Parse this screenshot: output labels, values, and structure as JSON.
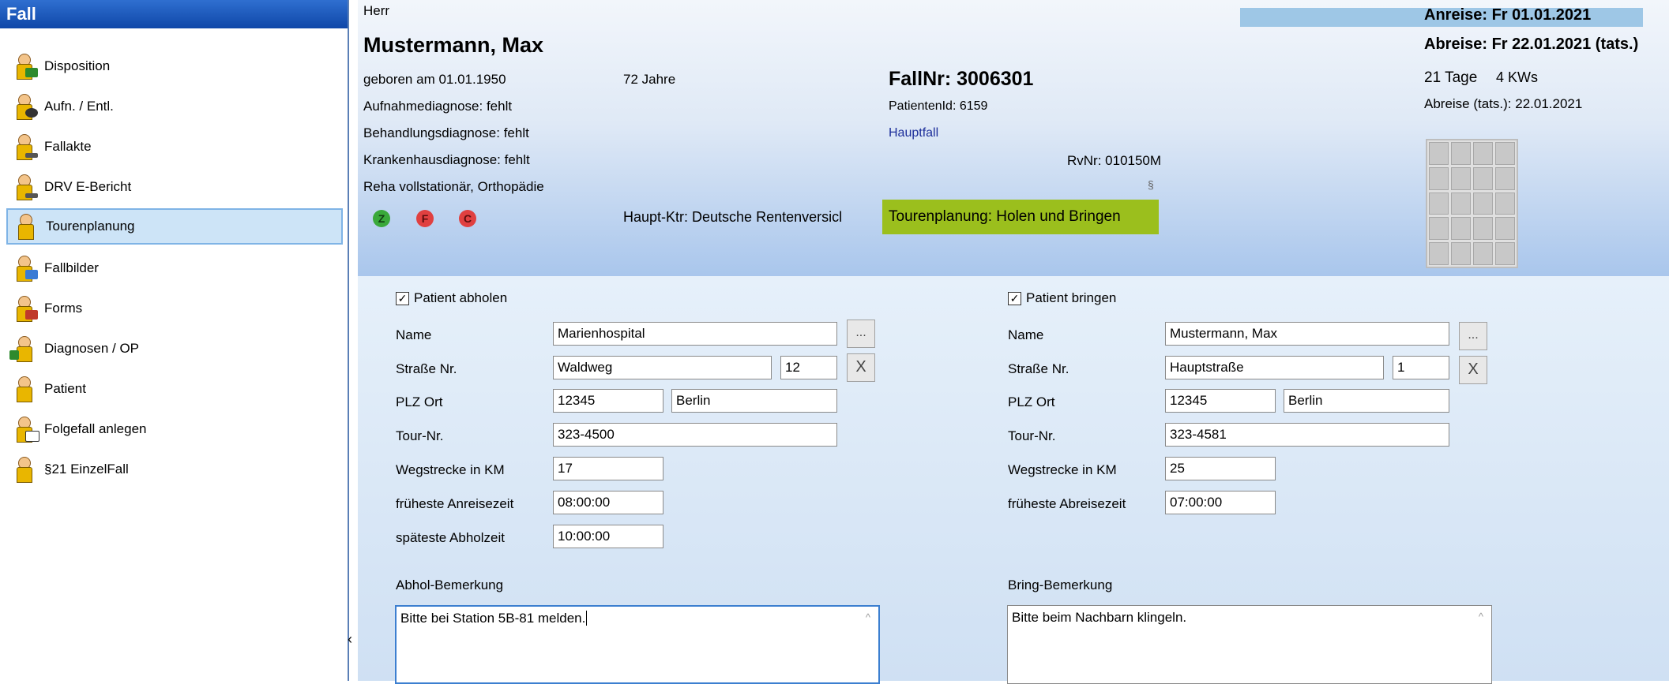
{
  "sidebar": {
    "title": "Fall",
    "items": [
      {
        "label": "Disposition"
      },
      {
        "label": "Aufn. / Entl."
      },
      {
        "label": "Fallakte"
      },
      {
        "label": "DRV E-Bericht"
      },
      {
        "label": "Tourenplanung"
      },
      {
        "label": "Fallbilder"
      },
      {
        "label": "Forms"
      },
      {
        "label": "Diagnosen / OP"
      },
      {
        "label": "Patient"
      },
      {
        "label": "Folgefall anlegen"
      },
      {
        "label": "§21 EinzelFall"
      }
    ],
    "collapse_glyph": "‹"
  },
  "header": {
    "salutation": "Herr",
    "patient_name": "Mustermann, Max",
    "birth": "geboren am 01.01.1950",
    "age": "72 Jahre",
    "admission_diagnosis": "Aufnahmediagnose: fehlt",
    "treatment_diagnosis": "Behandlungsdiagnose: fehlt",
    "hospital_diagnosis": "Krankenhausdiagnose: fehlt",
    "rehab_type": "Reha vollstationär, Orthopädie",
    "badges": [
      {
        "letter": "Z",
        "color": "#3aa93a"
      },
      {
        "letter": "F",
        "color": "#e04040"
      },
      {
        "letter": "C",
        "color": "#e04040"
      }
    ],
    "payer": "Haupt-Ktr: Deutsche Rentenversicl",
    "case_number": "FallNr: 3006301",
    "patient_id": "PatientenId: 6159",
    "case_type": "Hauptfall",
    "rv_number": "RvNr:  010150M",
    "section_symbol": "§",
    "tour_badge": "Tourenplanung: Holen und Bringen",
    "arrival": "Anreise: Fr 01.01.2021",
    "departure": "Abreise: Fr 22.01.2021 (tats.)",
    "duration": "21 Tage",
    "kws": "4 KWs",
    "departure_actual": "Abreise (tats.): 22.01.2021"
  },
  "pickup": {
    "checkbox_label": "Patient abholen",
    "checked": true,
    "labels": {
      "name": "Name",
      "street": "Straße Nr.",
      "zip_city": "PLZ Ort",
      "tour": "Tour-Nr.",
      "distance": "Wegstrecke in KM",
      "earliest": "früheste Anreisezeit",
      "latest": "späteste Abholzeit",
      "remark": "Abhol-Bemerkung"
    },
    "values": {
      "name": "Marienhospital",
      "street": "Waldweg",
      "number": "12",
      "zip": "12345",
      "city": "Berlin",
      "tour": "323-4500",
      "distance": "17",
      "earliest": "08:00:00",
      "latest": "10:00:00",
      "remark": "Bitte bei Station 5B-81 melden."
    },
    "browse_glyph": "...",
    "clear_glyph": "X"
  },
  "dropoff": {
    "checkbox_label": "Patient bringen",
    "checked": true,
    "labels": {
      "name": "Name",
      "street": "Straße Nr.",
      "zip_city": "PLZ Ort",
      "tour": "Tour-Nr.",
      "distance": "Wegstrecke in KM",
      "earliest": "früheste Abreisezeit",
      "remark": "Bring-Bemerkung"
    },
    "values": {
      "name": "Mustermann, Max",
      "street": "Hauptstraße",
      "number": "1",
      "zip": "12345",
      "city": "Berlin",
      "tour": "323-4581",
      "distance": "25",
      "earliest": "07:00:00",
      "remark": "Bitte beim Nachbarn klingeln."
    },
    "browse_glyph": "...",
    "clear_glyph": "X"
  },
  "check_glyph": "✓",
  "scroll_glyph": "^"
}
